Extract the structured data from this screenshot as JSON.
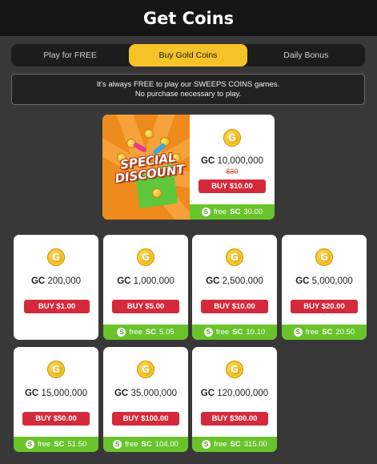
{
  "header": {
    "title": "Get Coins"
  },
  "tabs": [
    {
      "label": "Play for FREE",
      "active": false
    },
    {
      "label": "Buy Gold Coins",
      "active": true
    },
    {
      "label": "Daily Bonus",
      "active": false
    }
  ],
  "notice": {
    "line1": "It's always FREE to play our SWEEPS COINS games.",
    "line2": "No purchase necessary to play."
  },
  "featured": {
    "promo_text_line1": "SPECIAL",
    "promo_text_line2": "DISCOUNT",
    "coin_letter": "G",
    "gc_prefix": "GC",
    "gc_amount": "10,000,000",
    "old_price": "$30",
    "buy_label": "BUY $10.00",
    "bonus_prefix": "free",
    "bonus_currency": "SC",
    "bonus_amount": "30.00"
  },
  "packages": [
    {
      "gc_prefix": "GC",
      "gc_amount": "200,000",
      "buy_label": "BUY $1.00",
      "has_bonus": false
    },
    {
      "gc_prefix": "GC",
      "gc_amount": "1,000,000",
      "buy_label": "BUY $5.00",
      "has_bonus": true,
      "bonus_prefix": "free",
      "bonus_currency": "SC",
      "bonus_amount": "5.05"
    },
    {
      "gc_prefix": "GC",
      "gc_amount": "2,500,000",
      "buy_label": "BUY $10.00",
      "has_bonus": true,
      "bonus_prefix": "free",
      "bonus_currency": "SC",
      "bonus_amount": "10.10"
    },
    {
      "gc_prefix": "GC",
      "gc_amount": "5,000,000",
      "buy_label": "BUY $20.00",
      "has_bonus": true,
      "bonus_prefix": "free",
      "bonus_currency": "SC",
      "bonus_amount": "20.50"
    },
    {
      "gc_prefix": "GC",
      "gc_amount": "15,000,000",
      "buy_label": "BUY $50.00",
      "has_bonus": true,
      "bonus_prefix": "free",
      "bonus_currency": "SC",
      "bonus_amount": "51.50"
    },
    {
      "gc_prefix": "GC",
      "gc_amount": "35,000,000",
      "buy_label": "BUY $100.00",
      "has_bonus": true,
      "bonus_prefix": "free",
      "bonus_currency": "SC",
      "bonus_amount": "104.00"
    },
    {
      "gc_prefix": "GC",
      "gc_amount": "120,000,000",
      "buy_label": "BUY $300.00",
      "has_bonus": true,
      "bonus_prefix": "free",
      "bonus_currency": "SC",
      "bonus_amount": "315.00"
    }
  ],
  "coin_letter": "G",
  "bonus_icon_letter": "S",
  "colors": {
    "accent_yellow": "#f5c228",
    "buy_red": "#d42a3c",
    "bonus_green": "#68c42a",
    "background": "#383838",
    "header": "#161616"
  }
}
